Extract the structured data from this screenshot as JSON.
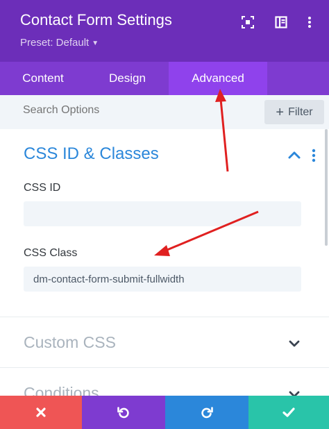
{
  "header": {
    "title": "Contact Form Settings",
    "preset": "Preset: Default",
    "background": "#6c2eb9",
    "icons": [
      "focus-icon",
      "split-view-icon",
      "more-vertical-icon"
    ]
  },
  "tabs": [
    {
      "label": "Content",
      "active": false
    },
    {
      "label": "Design",
      "active": false
    },
    {
      "label": "Advanced",
      "active": true
    }
  ],
  "search": {
    "placeholder": "Search Options",
    "filter_label": "Filter"
  },
  "css_section": {
    "title": "CSS ID & Classes",
    "expanded": true,
    "css_id_label": "CSS ID",
    "css_id_value": "",
    "css_class_label": "CSS Class",
    "css_class_value": "dm-contact-form-submit-fullwidth"
  },
  "collapsed_sections": [
    {
      "title": "Custom CSS"
    },
    {
      "title": "Conditions"
    }
  ],
  "footer": {
    "buttons": [
      {
        "name": "discard",
        "icon": "close-icon",
        "color": "#ef5555"
      },
      {
        "name": "undo",
        "icon": "undo-icon",
        "color": "#7e3bd0"
      },
      {
        "name": "redo",
        "icon": "redo-icon",
        "color": "#2b87da"
      },
      {
        "name": "save",
        "icon": "check-icon",
        "color": "#29c4a9"
      }
    ]
  },
  "colors": {
    "accent": "#2b87da",
    "annotation_arrow": "#e02020"
  }
}
